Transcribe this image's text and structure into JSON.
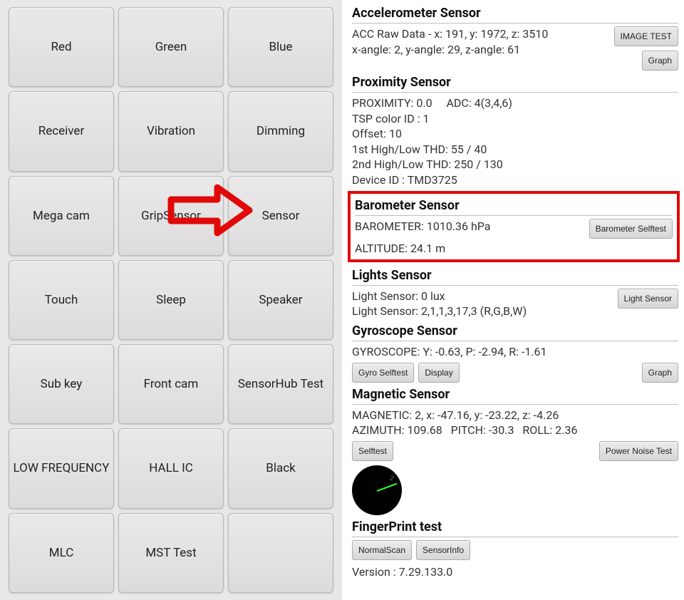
{
  "grid": [
    {
      "label": "Red"
    },
    {
      "label": "Green"
    },
    {
      "label": "Blue"
    },
    {
      "label": "Receiver"
    },
    {
      "label": "Vibration"
    },
    {
      "label": "Dimming"
    },
    {
      "label": "Mega cam"
    },
    {
      "label": "GripSensor"
    },
    {
      "label": "Sensor"
    },
    {
      "label": "Touch"
    },
    {
      "label": "Sleep"
    },
    {
      "label": "Speaker"
    },
    {
      "label": "Sub key"
    },
    {
      "label": "Front cam"
    },
    {
      "label": "SensorHub Test"
    },
    {
      "label": "LOW FREQUENCY"
    },
    {
      "label": "HALL IC"
    },
    {
      "label": "Black"
    },
    {
      "label": "MLC"
    },
    {
      "label": "MST Test"
    },
    {
      "label": ""
    }
  ],
  "accel": {
    "title": "Accelerometer Sensor",
    "line1": "ACC Raw Data - x: 191, y: 1972, z: 3510",
    "line2": "x-angle: 2, y-angle: 29, z-angle: 61",
    "btn_image": "IMAGE TEST",
    "btn_graph": "Graph"
  },
  "prox": {
    "title": "Proximity Sensor",
    "l1": "PROXIMITY: 0.0     ADC: 4(3,4,6)",
    "l2": "TSP color ID : 1",
    "l3": "Offset: 10",
    "l4": "1st High/Low THD: 55 / 40",
    "l5": "2nd High/Low THD: 250 / 130",
    "l6": "Device ID : TMD3725"
  },
  "baro": {
    "title": "Barometer Sensor",
    "l1": "BAROMETER: 1010.36 hPa",
    "l2": "ALTITUDE: 24.1 m",
    "btn": "Barometer Selftest"
  },
  "light": {
    "title": "Lights Sensor",
    "l1": "Light Sensor: 0 lux",
    "l2": "Light Sensor: 2,1,1,3,17,3 (R,G,B,W)",
    "btn": "Light Sensor"
  },
  "gyro": {
    "title": "Gyroscope Sensor",
    "l1": "GYROSCOPE: Y: -0.63, P: -2.94, R: -1.61",
    "btn_self": "Gyro Selftest",
    "btn_disp": "Display",
    "btn_graph": "Graph"
  },
  "mag": {
    "title": "Magnetic Sensor",
    "l1": "MAGNETIC: 2, x: -47.16, y: -23.22, z: -4.26",
    "l2": "AZIMUTH: 109.68   PITCH: -30.3   ROLL: 2.36",
    "btn_self": "Selftest",
    "btn_noise": "Power Noise Test",
    "compass_val": "2"
  },
  "finger": {
    "title": "FingerPrint test",
    "btn_scan": "NormalScan",
    "btn_info": "SensorInfo",
    "version": "Version : 7.29.133.0"
  }
}
